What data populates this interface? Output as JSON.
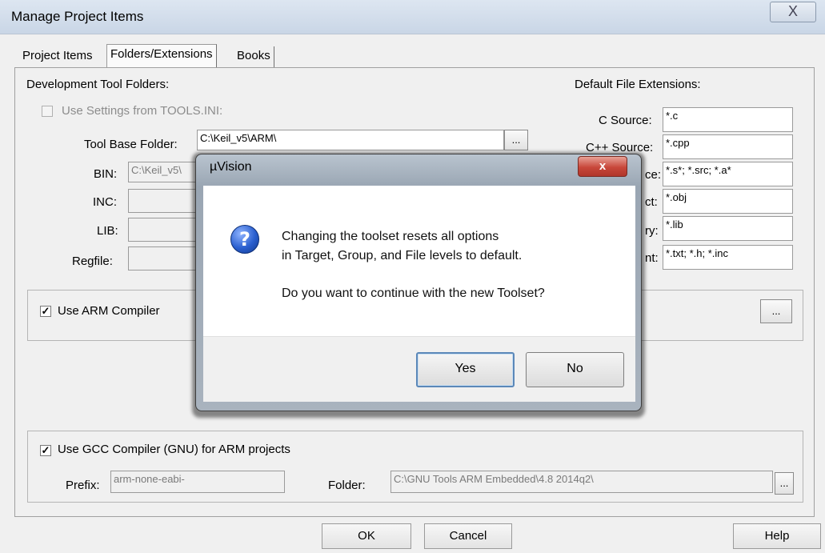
{
  "window": {
    "title": "Manage Project Items",
    "close_glyph": "X"
  },
  "tabs": [
    "Project Items",
    "Folders/Extensions",
    "Books"
  ],
  "dev_tools": {
    "heading": "Development Tool Folders:",
    "use_tools_ini_label": "Use Settings from TOOLS.INI:",
    "tool_base_label": "Tool Base Folder:",
    "tool_base_value": "C:\\Keil_v5\\ARM\\",
    "bin_label": "BIN:",
    "bin_value": "C:\\Keil_v5\\",
    "inc_label": "INC:",
    "lib_label": "LIB:",
    "regfile_label": "Regfile:",
    "browse_label": "..."
  },
  "extensions": {
    "heading": "Default File Extensions:",
    "items": [
      {
        "label": "C Source:",
        "value": "*.c"
      },
      {
        "label": "C++ Source:",
        "value": "*.cpp"
      },
      {
        "label": "ce:",
        "value": "*.s*; *.src; *.a*"
      },
      {
        "label": "ct:",
        "value": "*.obj"
      },
      {
        "label": "ry:",
        "value": "*.lib"
      },
      {
        "label": "nt:",
        "value": "*.txt; *.h; *.inc"
      }
    ]
  },
  "arm_compiler": {
    "label": "Use ARM Compiler",
    "checked": true,
    "browse_label": "..."
  },
  "gcc": {
    "label": "Use GCC Compiler (GNU) for ARM projects",
    "checked": true,
    "prefix_label": "Prefix:",
    "prefix_value": "arm-none-eabi-",
    "folder_label": "Folder:",
    "folder_value": "C:\\GNU Tools ARM Embedded\\4.8 2014q2\\",
    "browse_label": "..."
  },
  "footer": {
    "ok": "OK",
    "cancel": "Cancel",
    "help": "Help"
  },
  "dialog": {
    "title": "µVision",
    "close_glyph": "x",
    "icon_glyph": "?",
    "line1": "Changing the toolset resets all options",
    "line2": "in Target, Group, and File levels to default.",
    "line3": "Do you want to continue with the new Toolset?",
    "yes": "Yes",
    "no": "No"
  },
  "check_glyph": "✓"
}
